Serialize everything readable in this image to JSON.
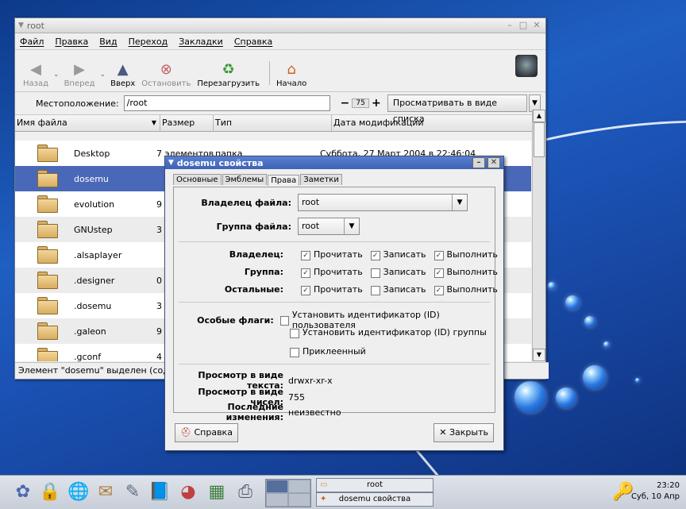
{
  "window": {
    "title": "root",
    "menu": [
      "Файл",
      "Правка",
      "Вид",
      "Переход",
      "Закладки",
      "Справка"
    ],
    "toolbar": {
      "back": "Назад",
      "forward": "Вперед",
      "up": "Вверх",
      "stop": "Остановить",
      "reload": "Перезагрузить",
      "home": "Начало"
    },
    "location": {
      "label": "Местоположение:",
      "value": "/root",
      "zoom": "75",
      "view_button": "Просматривать в виде списка"
    },
    "columns": [
      "Имя файла",
      "Размер",
      "Тип",
      "Дата модификации"
    ],
    "files": [
      {
        "name": "Desktop",
        "size": "7 элементов",
        "type": "папка",
        "date": "Суббота, 27 Март 2004 в 22:46:04"
      },
      {
        "name": "dosemu",
        "size": "",
        "type": "",
        "date": ""
      },
      {
        "name": "evolution",
        "size": "9",
        "type": "",
        "date": ""
      },
      {
        "name": "GNUstep",
        "size": "3",
        "type": "",
        "date": ""
      },
      {
        "name": ".alsaplayer",
        "size": "",
        "type": "",
        "date": ""
      },
      {
        "name": ".designer",
        "size": "0",
        "type": "",
        "date": ""
      },
      {
        "name": ".dosemu",
        "size": "3",
        "type": "",
        "date": ""
      },
      {
        "name": ".galeon",
        "size": "9",
        "type": "",
        "date": ""
      },
      {
        "name": ".gconf",
        "size": "4",
        "type": "",
        "date": ""
      }
    ],
    "status": "Элемент \"dosemu\" выделен (содер"
  },
  "dialog": {
    "title": "dosemu свойства",
    "tabs": [
      "Основные",
      "Эмблемы",
      "Права",
      "Заметки"
    ],
    "owner_label": "Владелец файла:",
    "owner_value": "root",
    "group_label": "Группа файла:",
    "group_value": "root",
    "perm_rows": [
      {
        "label": "Владелец:",
        "read": "Прочитать",
        "write": "Записать",
        "exec": "Выполнить"
      },
      {
        "label": "Группа:",
        "read": "Прочитать",
        "write": "Записать",
        "exec": "Выполнить"
      },
      {
        "label": "Остальные:",
        "read": "Прочитать",
        "write": "Записать",
        "exec": "Выполнить"
      }
    ],
    "special_label": "Особые флаги:",
    "special_flags": [
      "Установить идентификатор (ID) пользователя",
      "Установить идентификатор (ID) группы",
      "Приклеенный"
    ],
    "text_view_label": "Просмотр в виде текста:",
    "text_view_value": "drwxr-xr-x",
    "num_view_label": "Просмотр в виде чисел:",
    "num_view_value": "755",
    "last_change_label": "Последние изменения:",
    "last_change_value": "неизвестно",
    "help_button": "Справка",
    "close_button": "Закрыть"
  },
  "panel": {
    "tasks": [
      "root",
      "dosemu свойства"
    ],
    "clock_time": "23:20",
    "clock_date": "Суб, 10 Апр"
  }
}
